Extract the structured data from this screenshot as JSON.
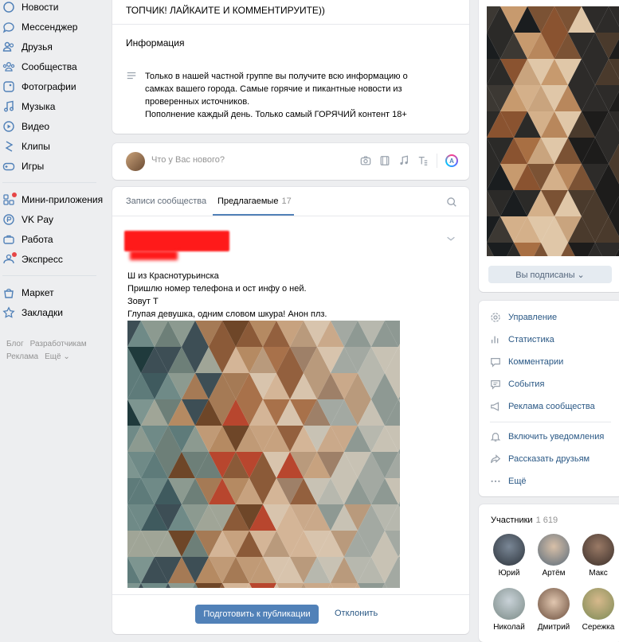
{
  "sidebar": {
    "items": [
      {
        "label": "Новости",
        "icon": "news-icon"
      },
      {
        "label": "Мессенджер",
        "icon": "messenger-icon"
      },
      {
        "label": "Друзья",
        "icon": "friends-icon"
      },
      {
        "label": "Сообщества",
        "icon": "communities-icon"
      },
      {
        "label": "Фотографии",
        "icon": "photos-icon"
      },
      {
        "label": "Музыка",
        "icon": "music-icon"
      },
      {
        "label": "Видео",
        "icon": "video-icon"
      },
      {
        "label": "Клипы",
        "icon": "clips-icon"
      },
      {
        "label": "Игры",
        "icon": "games-icon"
      },
      {
        "label": "Мини-приложения",
        "icon": "mini-apps-icon"
      },
      {
        "label": "VK Pay",
        "icon": "vkpay-icon"
      },
      {
        "label": "Работа",
        "icon": "work-icon"
      },
      {
        "label": "Экспресс",
        "icon": "express-icon"
      },
      {
        "label": "Маркет",
        "icon": "market-icon"
      },
      {
        "label": "Закладки",
        "icon": "bookmarks-icon"
      }
    ],
    "footer": [
      "Блог",
      "Разработчикам",
      "Реклама",
      "Ещё ⌄"
    ]
  },
  "info": {
    "title_cut": "ТОПЧИК! ЛАЙКАИТЕ И КОММЕНТИРУИТЕ))",
    "heading": "Информация",
    "text": "Только в нашей частной группе вы получите всю информацию о\nсамках вашего города. Самые горячие и пикантные новости из\nпроверенных источников.\nПополнение каждый день. Только самый ГОРЯЧИЙ контент 18+"
  },
  "post_box": {
    "placeholder": "Что у Вас нового?",
    "badge": "A"
  },
  "feed": {
    "tab_records": "Записи сообщества",
    "tab_suggested": "Предлагаемые",
    "tab_suggested_count": "17",
    "post_text": "Ш       из Краснотурьинска\nПришлю номер телефона и ост инфу о ней.\nЗовут Т\nГлупая девушка, одним словом шкура! Анон плз.",
    "btn_publish": "Подготовить к публикации",
    "btn_reject": "Отклонить"
  },
  "right": {
    "subscribed": "Вы подписаны ⌄",
    "menu": {
      "manage": "Управление",
      "stats": "Статистика",
      "comments": "Комментарии",
      "events": "События",
      "ads": "Реклама сообщества",
      "notify": "Включить уведомления",
      "share": "Рассказать друзьям",
      "more": "Ещё"
    },
    "members_title": "Участники",
    "members_count": "1 619",
    "members": [
      "Юрий",
      "Артём",
      "Макс",
      "Николай",
      "Дмитрий",
      "Сережка"
    ]
  },
  "colors": {
    "accent": "#5181b8",
    "link": "#2a5885",
    "background": "#edeef0",
    "redaction": "#ff1a1a"
  }
}
